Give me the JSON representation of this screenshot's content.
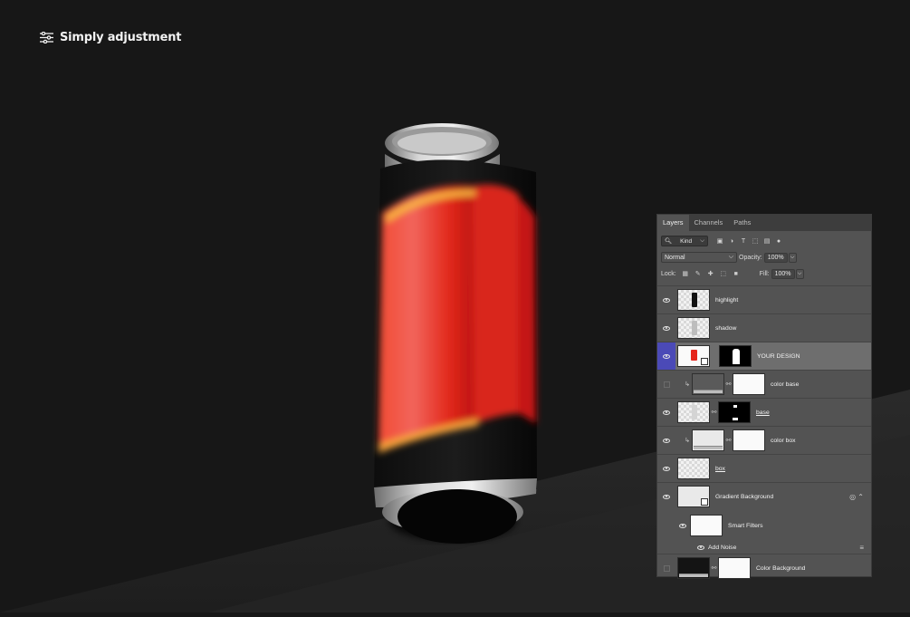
{
  "brand": {
    "title": "Simply adjustment",
    "icon": "sliders-icon"
  },
  "layers_panel": {
    "tabs": [
      {
        "label": "Layers",
        "active": true
      },
      {
        "label": "Channels",
        "active": false
      },
      {
        "label": "Paths",
        "active": false
      }
    ],
    "filter_kind": "Kind",
    "blend_mode": "Normal",
    "opacity_label": "Opacity:",
    "opacity_value": "100%",
    "lock_label": "Lock:",
    "fill_label": "Fill:",
    "fill_value": "100%",
    "layers": [
      {
        "name": "highlight",
        "visible": true
      },
      {
        "name": "shadow",
        "visible": true
      },
      {
        "name": "YOUR DESIGN",
        "visible": true,
        "selected": true
      },
      {
        "name": "color base",
        "visible": false
      },
      {
        "name": "base",
        "visible": true
      },
      {
        "name": "color box",
        "visible": true
      },
      {
        "name": "box",
        "visible": true
      },
      {
        "name": "Gradient Background",
        "visible": true
      },
      {
        "name": "Smart Filters",
        "visible": true
      },
      {
        "name": "Add Noise",
        "visible": true
      },
      {
        "name": "Color Background",
        "visible": false
      }
    ]
  },
  "colors": {
    "background": "#171717",
    "can_red": "#e5251c",
    "selection_blue": "#4b4ab7"
  }
}
